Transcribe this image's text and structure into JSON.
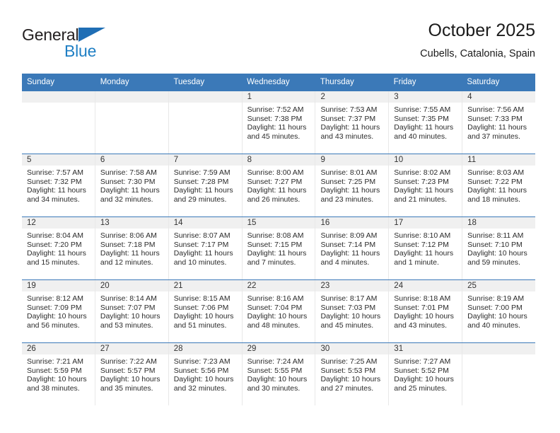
{
  "brand": {
    "name_part1": "General",
    "name_part2": "Blue",
    "flag_icon": "triangle-flag-icon",
    "color_dark": "#231f20",
    "color_blue": "#1f7fc4"
  },
  "header": {
    "title": "October 2025",
    "subtitle": "Cubells, Catalonia, Spain"
  },
  "calendar": {
    "header_bg": "#3b79b8",
    "header_text_color": "#ffffff",
    "day_band_bg": "#f0f0f0",
    "weekdays": [
      "Sunday",
      "Monday",
      "Tuesday",
      "Wednesday",
      "Thursday",
      "Friday",
      "Saturday"
    ],
    "weeks": [
      [
        {
          "day": "",
          "lines": []
        },
        {
          "day": "",
          "lines": []
        },
        {
          "day": "",
          "lines": []
        },
        {
          "day": "1",
          "lines": [
            "Sunrise: 7:52 AM",
            "Sunset: 7:38 PM",
            "Daylight: 11 hours",
            "and 45 minutes."
          ]
        },
        {
          "day": "2",
          "lines": [
            "Sunrise: 7:53 AM",
            "Sunset: 7:37 PM",
            "Daylight: 11 hours",
            "and 43 minutes."
          ]
        },
        {
          "day": "3",
          "lines": [
            "Sunrise: 7:55 AM",
            "Sunset: 7:35 PM",
            "Daylight: 11 hours",
            "and 40 minutes."
          ]
        },
        {
          "day": "4",
          "lines": [
            "Sunrise: 7:56 AM",
            "Sunset: 7:33 PM",
            "Daylight: 11 hours",
            "and 37 minutes."
          ]
        }
      ],
      [
        {
          "day": "5",
          "lines": [
            "Sunrise: 7:57 AM",
            "Sunset: 7:32 PM",
            "Daylight: 11 hours",
            "and 34 minutes."
          ]
        },
        {
          "day": "6",
          "lines": [
            "Sunrise: 7:58 AM",
            "Sunset: 7:30 PM",
            "Daylight: 11 hours",
            "and 32 minutes."
          ]
        },
        {
          "day": "7",
          "lines": [
            "Sunrise: 7:59 AM",
            "Sunset: 7:28 PM",
            "Daylight: 11 hours",
            "and 29 minutes."
          ]
        },
        {
          "day": "8",
          "lines": [
            "Sunrise: 8:00 AM",
            "Sunset: 7:27 PM",
            "Daylight: 11 hours",
            "and 26 minutes."
          ]
        },
        {
          "day": "9",
          "lines": [
            "Sunrise: 8:01 AM",
            "Sunset: 7:25 PM",
            "Daylight: 11 hours",
            "and 23 minutes."
          ]
        },
        {
          "day": "10",
          "lines": [
            "Sunrise: 8:02 AM",
            "Sunset: 7:23 PM",
            "Daylight: 11 hours",
            "and 21 minutes."
          ]
        },
        {
          "day": "11",
          "lines": [
            "Sunrise: 8:03 AM",
            "Sunset: 7:22 PM",
            "Daylight: 11 hours",
            "and 18 minutes."
          ]
        }
      ],
      [
        {
          "day": "12",
          "lines": [
            "Sunrise: 8:04 AM",
            "Sunset: 7:20 PM",
            "Daylight: 11 hours",
            "and 15 minutes."
          ]
        },
        {
          "day": "13",
          "lines": [
            "Sunrise: 8:06 AM",
            "Sunset: 7:18 PM",
            "Daylight: 11 hours",
            "and 12 minutes."
          ]
        },
        {
          "day": "14",
          "lines": [
            "Sunrise: 8:07 AM",
            "Sunset: 7:17 PM",
            "Daylight: 11 hours",
            "and 10 minutes."
          ]
        },
        {
          "day": "15",
          "lines": [
            "Sunrise: 8:08 AM",
            "Sunset: 7:15 PM",
            "Daylight: 11 hours",
            "and 7 minutes."
          ]
        },
        {
          "day": "16",
          "lines": [
            "Sunrise: 8:09 AM",
            "Sunset: 7:14 PM",
            "Daylight: 11 hours",
            "and 4 minutes."
          ]
        },
        {
          "day": "17",
          "lines": [
            "Sunrise: 8:10 AM",
            "Sunset: 7:12 PM",
            "Daylight: 11 hours",
            "and 1 minute."
          ]
        },
        {
          "day": "18",
          "lines": [
            "Sunrise: 8:11 AM",
            "Sunset: 7:10 PM",
            "Daylight: 10 hours",
            "and 59 minutes."
          ]
        }
      ],
      [
        {
          "day": "19",
          "lines": [
            "Sunrise: 8:12 AM",
            "Sunset: 7:09 PM",
            "Daylight: 10 hours",
            "and 56 minutes."
          ]
        },
        {
          "day": "20",
          "lines": [
            "Sunrise: 8:14 AM",
            "Sunset: 7:07 PM",
            "Daylight: 10 hours",
            "and 53 minutes."
          ]
        },
        {
          "day": "21",
          "lines": [
            "Sunrise: 8:15 AM",
            "Sunset: 7:06 PM",
            "Daylight: 10 hours",
            "and 51 minutes."
          ]
        },
        {
          "day": "22",
          "lines": [
            "Sunrise: 8:16 AM",
            "Sunset: 7:04 PM",
            "Daylight: 10 hours",
            "and 48 minutes."
          ]
        },
        {
          "day": "23",
          "lines": [
            "Sunrise: 8:17 AM",
            "Sunset: 7:03 PM",
            "Daylight: 10 hours",
            "and 45 minutes."
          ]
        },
        {
          "day": "24",
          "lines": [
            "Sunrise: 8:18 AM",
            "Sunset: 7:01 PM",
            "Daylight: 10 hours",
            "and 43 minutes."
          ]
        },
        {
          "day": "25",
          "lines": [
            "Sunrise: 8:19 AM",
            "Sunset: 7:00 PM",
            "Daylight: 10 hours",
            "and 40 minutes."
          ]
        }
      ],
      [
        {
          "day": "26",
          "lines": [
            "Sunrise: 7:21 AM",
            "Sunset: 5:59 PM",
            "Daylight: 10 hours",
            "and 38 minutes."
          ]
        },
        {
          "day": "27",
          "lines": [
            "Sunrise: 7:22 AM",
            "Sunset: 5:57 PM",
            "Daylight: 10 hours",
            "and 35 minutes."
          ]
        },
        {
          "day": "28",
          "lines": [
            "Sunrise: 7:23 AM",
            "Sunset: 5:56 PM",
            "Daylight: 10 hours",
            "and 32 minutes."
          ]
        },
        {
          "day": "29",
          "lines": [
            "Sunrise: 7:24 AM",
            "Sunset: 5:55 PM",
            "Daylight: 10 hours",
            "and 30 minutes."
          ]
        },
        {
          "day": "30",
          "lines": [
            "Sunrise: 7:25 AM",
            "Sunset: 5:53 PM",
            "Daylight: 10 hours",
            "and 27 minutes."
          ]
        },
        {
          "day": "31",
          "lines": [
            "Sunrise: 7:27 AM",
            "Sunset: 5:52 PM",
            "Daylight: 10 hours",
            "and 25 minutes."
          ]
        },
        {
          "day": "",
          "lines": []
        }
      ]
    ]
  }
}
